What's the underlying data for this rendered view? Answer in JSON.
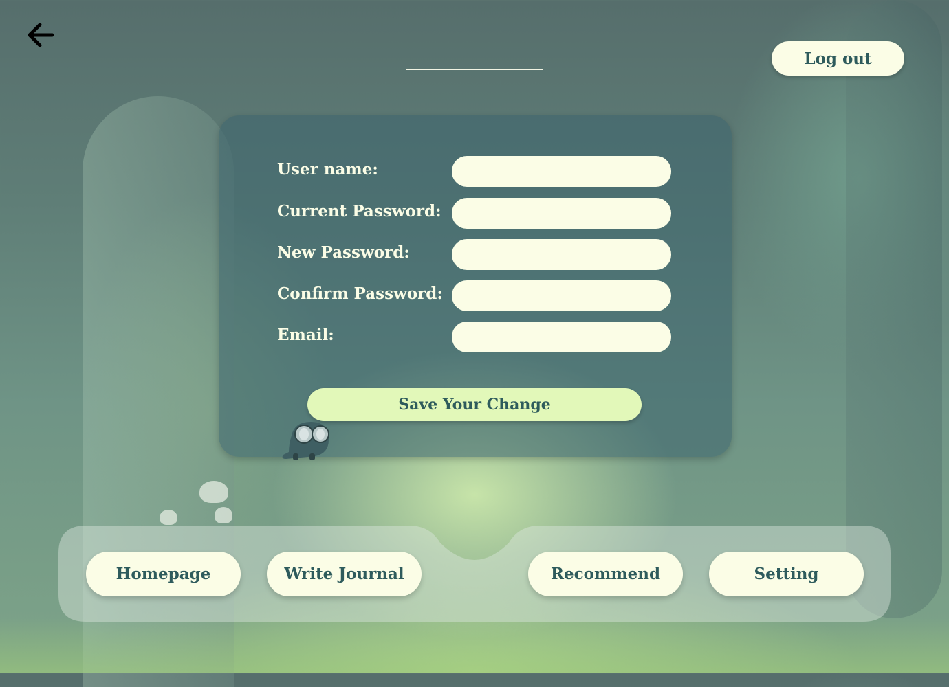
{
  "header": {
    "back_icon": "arrow-left-icon",
    "logout_label": "Log out"
  },
  "form": {
    "fields": [
      {
        "label": "User name:",
        "value": ""
      },
      {
        "label": "Current Password:",
        "value": ""
      },
      {
        "label": "New Password:",
        "value": ""
      },
      {
        "label": "Confirm Password:",
        "value": ""
      },
      {
        "label": "Email:",
        "value": ""
      }
    ],
    "save_label": "Save Your Change"
  },
  "nav": {
    "items": [
      {
        "label": "Homepage"
      },
      {
        "label": "Write Journal"
      },
      {
        "label": "Recommend"
      },
      {
        "label": "Setting"
      }
    ]
  },
  "colors": {
    "button_bg": "#fbfde6",
    "save_bg": "#e2f8b9",
    "text_dark": "#2e5b5c",
    "label_light": "#fbfde6"
  }
}
